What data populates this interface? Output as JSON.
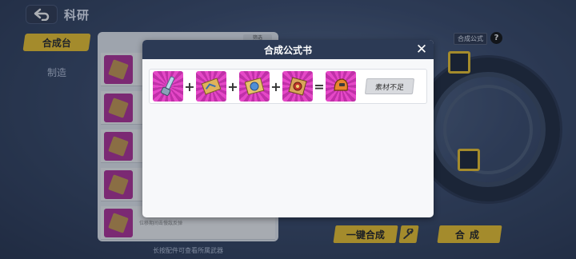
{
  "header": {
    "title": "科研"
  },
  "left_menu": {
    "active_tab": "合成台",
    "tab_2": "制造"
  },
  "background_list": {
    "sort_label": "筛选",
    "item_text": "位移期间击慢敌反弹",
    "footer": "长按配件可查看所属武器"
  },
  "right_panel": {
    "formula_label": "合成公式",
    "help": "?",
    "one_key_label": "一键合成",
    "craft_label": "合成"
  },
  "modal": {
    "title": "合成公式书",
    "close_symbol": "✕",
    "plus": "+",
    "equals": "=",
    "action_label": "素材不足",
    "ingredients": [
      "dagger-part-icon",
      "map-part-icon",
      "circuit-part-icon",
      "gear-part-icon"
    ],
    "result": "helmet-result-icon",
    "item_bg_color": "#d63cbb"
  }
}
